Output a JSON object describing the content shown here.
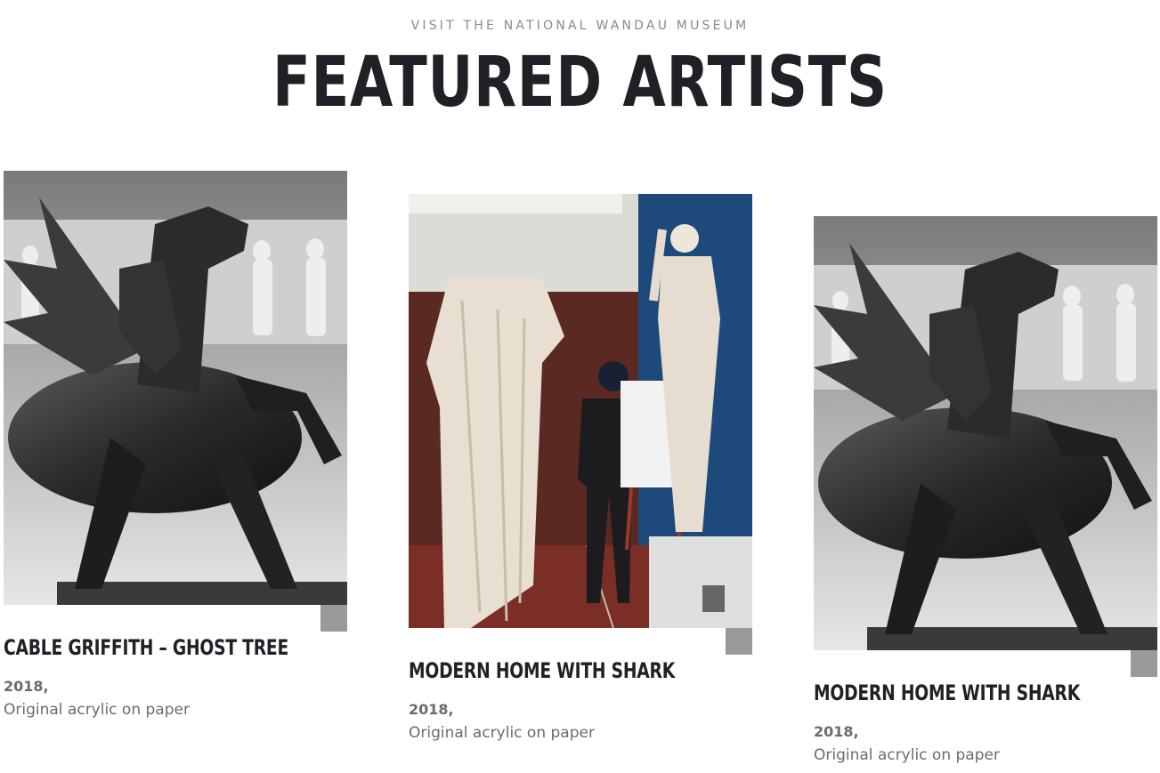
{
  "header": {
    "eyebrow": "VISIT THE NATIONAL WANDAU MUSEUM",
    "title": "FEATURED ARTISTS"
  },
  "cards": [
    {
      "title": "CABLE GRIFFITH – GHOST TREE",
      "year": "2018,",
      "medium": "Original acrylic on paper",
      "image": "bronze-pegasus-sculpture-image"
    },
    {
      "title": "MODERN HOME WITH SHARK",
      "year": "2018,",
      "medium": "Original acrylic on paper",
      "image": "museum-gallery-statues-image"
    },
    {
      "title": "MODERN HOME WITH SHARK",
      "year": "2018,",
      "medium": "Original acrylic on paper",
      "image": "bronze-pegasus-sculpture-image"
    }
  ],
  "colors": {
    "heading": "#1f2126",
    "muted": "#8a8a8a",
    "body_text": "#6b6b6b",
    "accent_corner": "#9a9a9a"
  }
}
